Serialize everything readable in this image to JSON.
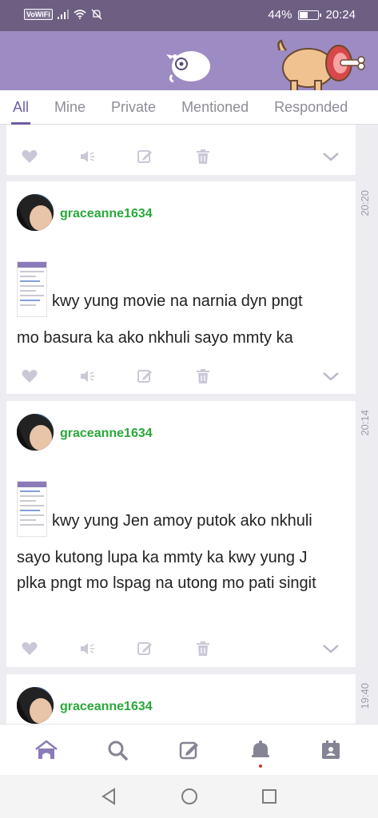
{
  "status_bar": {
    "wifi_label": "VoWiFi",
    "battery_percent": "44%",
    "battery_level": 0.44,
    "time": "20:24"
  },
  "tabs": [
    {
      "label": "All",
      "active": true
    },
    {
      "label": "Mine",
      "active": false
    },
    {
      "label": "Private",
      "active": false
    },
    {
      "label": "Mentioned",
      "active": false
    },
    {
      "label": "Responded",
      "active": false
    }
  ],
  "posts": [
    {
      "username": "graceanne1634",
      "time": "20:20",
      "text_first": "kwy yung movie na narnia dyn pngt",
      "text_rest": "mo basura ka ako nkhuli sayo mmty ka"
    },
    {
      "username": "graceanne1634",
      "time": "20:14",
      "text_first": "kwy yung Jen amoy putok ako nkhuli",
      "text_rest": "sayo kutong lupa ka mmty ka kwy yung J plka pngt mo lspag na utong mo pati singit"
    },
    {
      "username": "graceanne1634",
      "time": "19:40"
    }
  ],
  "icons": {
    "like": "heart-icon",
    "mute": "speaker-icon",
    "edit": "edit-icon",
    "delete": "trash-icon",
    "expand": "chevron-down-icon"
  },
  "colors": {
    "accent": "#6e5ca0",
    "banner": "#9d8bc3",
    "username": "#29a83a",
    "notification_dot": "#d0342c"
  }
}
